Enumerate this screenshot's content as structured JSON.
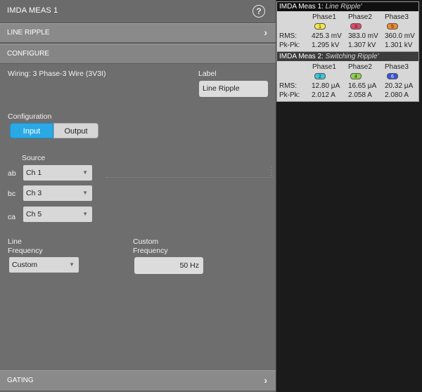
{
  "panel": {
    "title": "IMDA MEAS 1",
    "sections": {
      "line_ripple": "LINE RIPPLE",
      "configure": "CONFIGURE",
      "gating": "GATING"
    },
    "wiring": "Wiring: 3 Phase-3 Wire (3V3I)",
    "label_caption": "Label",
    "label_value": "Line Ripple",
    "configuration_caption": "Configuration",
    "config_options": {
      "input": "Input",
      "output": "Output",
      "selected": "Input"
    },
    "source_caption": "Source",
    "sources": [
      {
        "pair": "ab",
        "value": "Ch 1"
      },
      {
        "pair": "bc",
        "value": "Ch 3"
      },
      {
        "pair": "ca",
        "value": "Ch 5"
      }
    ],
    "line_frequency_caption_1": "Line",
    "line_frequency_caption_2": "Frequency",
    "line_frequency_value": "Custom",
    "custom_frequency_caption_1": "Custom",
    "custom_frequency_caption_2": "Frequency",
    "custom_frequency_value": "50 Hz"
  },
  "results": [
    {
      "title": "IMDA Meas 1:",
      "subtitle": "Line Ripple'",
      "phases": [
        "Phase1",
        "Phase2",
        "Phase3"
      ],
      "badges": [
        {
          "label": "1",
          "color": "#f4e64a"
        },
        {
          "label": "3",
          "color": "#e0476a"
        },
        {
          "label": "5",
          "color": "#f08a2a"
        }
      ],
      "rms_label": "RMS:",
      "pkpk_label": "Pk-Pk:",
      "rms": [
        "425.3 mV",
        "383.0 mV",
        "360.0 mV"
      ],
      "pkpk": [
        "1.295 kV",
        "1.307 kV",
        "1.301 kV"
      ]
    },
    {
      "title": "IMDA Meas 2:",
      "subtitle": "Switching Ripple'",
      "phases": [
        "Phase1",
        "Phase2",
        "Phase3"
      ],
      "badges": [
        {
          "label": "2",
          "color": "#3fc6d8"
        },
        {
          "label": "4",
          "color": "#8fd04a"
        },
        {
          "label": "6",
          "color": "#3a52d8"
        }
      ],
      "rms_label": "RMS:",
      "pkpk_label": "Pk-Pk:",
      "rms": [
        "12.80 μA",
        "16.65 μA",
        "20.32 μA"
      ],
      "pkpk": [
        "2.012 A",
        "2.058 A",
        "2.080 A"
      ]
    }
  ]
}
